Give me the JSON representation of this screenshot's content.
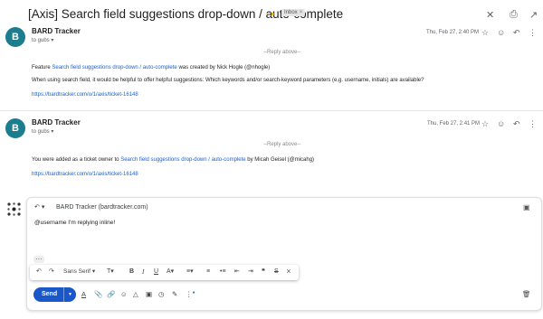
{
  "thread": {
    "subject": "[Axis] Search field suggestions drop-down / auto-complete",
    "label": "Inbox",
    "label_close": "×"
  },
  "messages": [
    {
      "avatar_letter": "B",
      "sender": "BARD Tracker",
      "to": "to gubs",
      "date": "Thu, Feb 27, 2:40 PM",
      "reply_above": "--Reply above--",
      "line1_prefix": "Feature ",
      "line1_link": "Search field suggestions drop-down / auto-complete",
      "line1_suffix": " was created by Nick Hogle (@nhogle)",
      "line2": "When using search field, it would be helpful to offer helpful suggestions: Which keywords and/or search-keyword parameters (e.g. username, initials) are available?",
      "url": "https://bardtracker.com/o/1/axis/ticket-16148"
    },
    {
      "avatar_letter": "B",
      "sender": "BARD Tracker",
      "to": "to gubs",
      "date": "Thu, Feb 27, 2:41 PM",
      "reply_above": "--Reply above--",
      "line1_prefix": "You were added as a ticket owner to ",
      "line1_link": "Search field suggestions drop-down / auto-complete",
      "line1_suffix": " by Micah Geisel (@micahg)",
      "url": "https://bardtracker.com/o/1/axis/ticket-16148"
    }
  ],
  "compose": {
    "recipient": "BARD Tracker (bardtracker.com)",
    "text": "@username I'm replying inline!",
    "font": "Sans Serif",
    "send_label": "Send",
    "more_label": "···"
  },
  "colors": {
    "avatar": "#1c7d8f",
    "send": "#1a57c8",
    "link": "#1a61d0",
    "important": "#e8b400"
  }
}
